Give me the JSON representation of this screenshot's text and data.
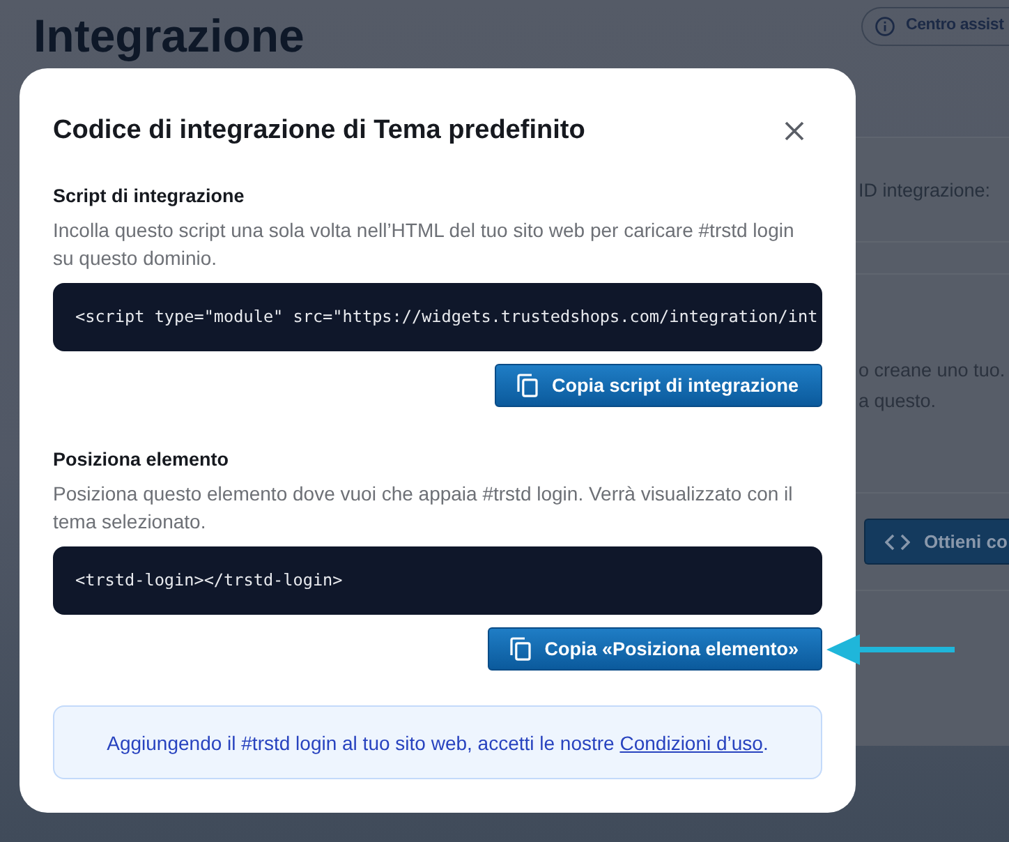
{
  "background_page": {
    "title": "Integrazione",
    "help_button": {
      "label": "Centro assist"
    },
    "side_card": {
      "field_label": "ID integrazione:",
      "text_lines": [
        "o creane uno tuo.",
        "a questo."
      ],
      "button": {
        "label": "Ottieni co"
      }
    }
  },
  "dialog": {
    "title": "Codice di integrazione di Tema predefinito",
    "sections": [
      {
        "heading": "Script di integrazione",
        "description": "Incolla questo script una sola volta nell’HTML del tuo sito web per caricare #trstd login su questo dominio.",
        "code": "<script type=\"module\" src=\"https://widgets.trustedshops.com/integration/int",
        "copy_button": "Copia script di integrazione"
      },
      {
        "heading": "Posiziona elemento",
        "description": "Posiziona questo elemento dove vuoi che appaia #trstd login. Verrà visualizzato con il tema selezionato.",
        "code": "<trstd-login></trstd-login>",
        "copy_button": "Copia «Posiziona elemento»"
      }
    ],
    "notice": {
      "text": "Aggiungendo il #trstd login al tuo sito web, accetti le nostre",
      "link": "Condizioni d’uso",
      "end": "."
    }
  }
}
